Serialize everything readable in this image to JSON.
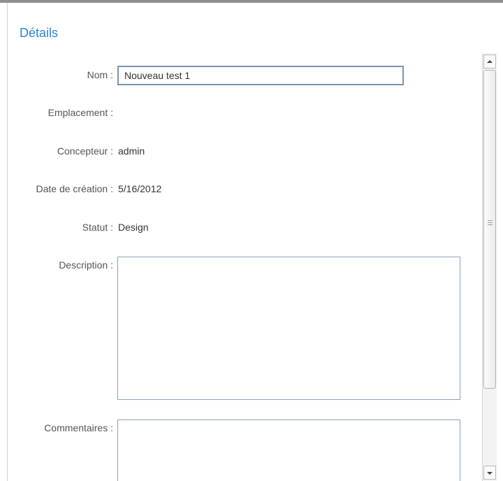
{
  "section": {
    "title": "Détails"
  },
  "fields": {
    "nom": {
      "label": "Nom :",
      "value": "Nouveau test 1"
    },
    "emplacement": {
      "label": "Emplacement :",
      "value": ""
    },
    "concepteur": {
      "label": "Concepteur :",
      "value": "admin"
    },
    "date_creation": {
      "label": "Date de création :",
      "value": "5/16/2012"
    },
    "statut": {
      "label": "Statut :",
      "value": "Design"
    },
    "description": {
      "label": "Description :",
      "value": ""
    },
    "commentaires": {
      "label": "Commentaires :",
      "value": ""
    }
  },
  "icons": {
    "scroll_up": "chevron-up-icon",
    "scroll_down": "chevron-down-icon",
    "grip": "grip-lines-icon"
  },
  "colors": {
    "title": "#2a83d6",
    "input_border": "#7c93ad",
    "top_bar": "#8f8f8f"
  }
}
